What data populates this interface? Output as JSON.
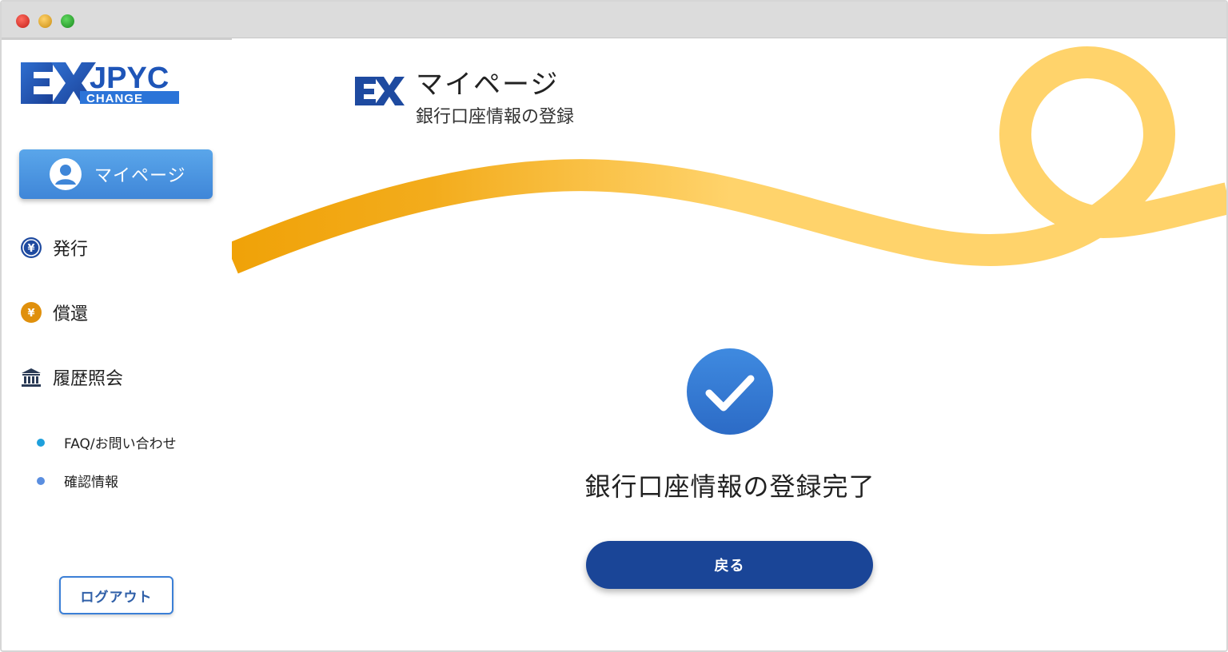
{
  "colors": {
    "brand_blue": "#1a4597",
    "accent_blue": "#3f86d8",
    "ribbon_orange": "#f2a60f",
    "ribbon_yellow": "#ffd36b",
    "issue_icon": "#1e4aa0",
    "redeem_icon": "#e0900c",
    "faq_bullet": "#1ea0dc",
    "confirm_bullet": "#5a8ee0"
  },
  "sidebar": {
    "logo": {
      "text": "JPYC",
      "subtext": "CHANGE",
      "icon": "ex-logo"
    },
    "mypage_button": {
      "label": "マイページ",
      "icon": "user-avatar-icon"
    },
    "nav": [
      {
        "label": "発行",
        "icon": "yen-circle-blue-icon"
      },
      {
        "label": "償還",
        "icon": "yen-circle-orange-icon"
      },
      {
        "label": "履歴照会",
        "icon": "bank-icon"
      }
    ],
    "sub": [
      {
        "label": "FAQ/お問い合わせ"
      },
      {
        "label": "確認情報"
      }
    ],
    "logout_label": "ログアウト"
  },
  "header": {
    "title": "マイページ",
    "subtitle": "銀行口座情報の登録"
  },
  "main": {
    "completion_message": "銀行口座情報の登録完了",
    "back_label": "戻る",
    "check_icon": "check-circle-icon"
  }
}
